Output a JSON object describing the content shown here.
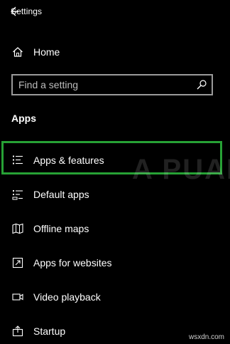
{
  "window": {
    "title": "Settings",
    "back_icon": "back-arrow-icon"
  },
  "home": {
    "label": "Home",
    "icon": "home-icon"
  },
  "search": {
    "placeholder": "Find a setting",
    "value": "",
    "icon": "search-icon"
  },
  "section": {
    "title": "Apps"
  },
  "nav": {
    "items": [
      {
        "label": "Apps & features",
        "icon": "apps-list-icon",
        "selected": true
      },
      {
        "label": "Default apps",
        "icon": "default-apps-icon"
      },
      {
        "label": "Offline maps",
        "icon": "map-icon"
      },
      {
        "label": "Apps for websites",
        "icon": "external-link-icon"
      },
      {
        "label": "Video playback",
        "icon": "video-icon"
      },
      {
        "label": "Startup",
        "icon": "startup-icon"
      }
    ]
  },
  "watermark": {
    "text": "A PUALS"
  },
  "footer": {
    "site": "wsxdn.com"
  },
  "colors": {
    "background": "#000000",
    "text": "#ffffff",
    "highlight_border": "#27a135",
    "search_border": "#9a9a9a"
  }
}
